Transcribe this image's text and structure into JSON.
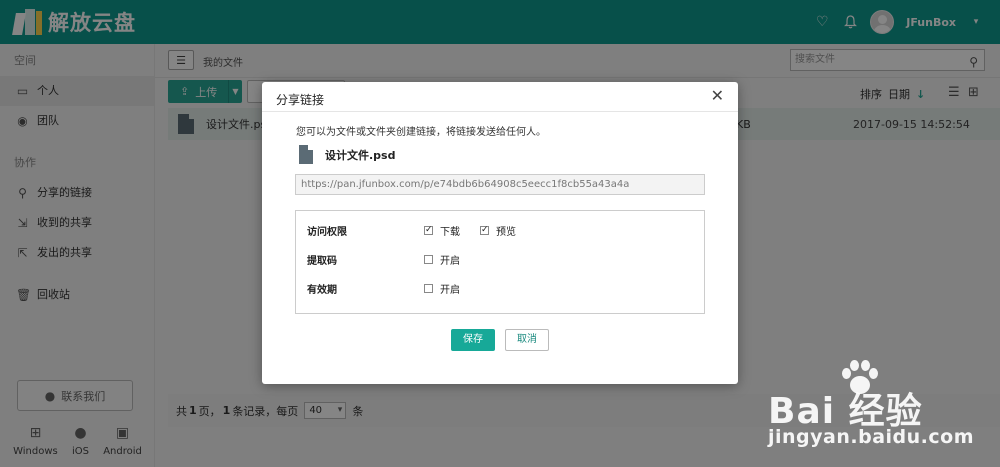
{
  "header": {
    "logo_text": "解放云盘",
    "username": "JFunBox"
  },
  "sidebar": {
    "section_space": "空间",
    "item_personal": "个人",
    "item_team": "团队",
    "section_collab": "协作",
    "item_shared_links": "分享的链接",
    "item_received": "收到的共享",
    "item_sent": "发出的共享",
    "item_trash": "回收站",
    "contact": "联系我们",
    "platforms": [
      "Windows",
      "iOS",
      "Android"
    ]
  },
  "main": {
    "breadcrumb": "我的文件",
    "search_placeholder": "搜索文件",
    "upload_label": "上传",
    "sort_label": "排序",
    "sort_field": "日期",
    "file": {
      "name": "设计文件.psd",
      "size_suffix": "KB",
      "date": "2017-09-15 14:52:54"
    },
    "pager": {
      "prefix": "共",
      "pages": "1",
      "pages_unit": "页，",
      "records": "1",
      "records_unit": "条记录，每页",
      "per_page": "40",
      "per_page_unit": "条"
    }
  },
  "modal": {
    "title": "分享链接",
    "description": "您可以为文件或文件夹创建链接，将链接发送给任何人。",
    "file_name": "设计文件.psd",
    "link": "https://pan.jfunbox.com/p/e74bdb6b64908c5eecc1f8cb55a43a4a",
    "access_label": "访问权限",
    "download_label": "下载",
    "download_checked": true,
    "preview_label": "预览",
    "preview_checked": true,
    "code_label": "提取码",
    "code_option": "开启",
    "code_checked": false,
    "expiry_label": "有效期",
    "expiry_option": "开启",
    "expiry_checked": false,
    "save_label": "保存",
    "cancel_label": "取消"
  },
  "watermark": {
    "brand": "Bai 经验",
    "url": "jingyan.baidu.com"
  },
  "colors": {
    "header": "#0f9a8e",
    "accent": "#17a998"
  }
}
